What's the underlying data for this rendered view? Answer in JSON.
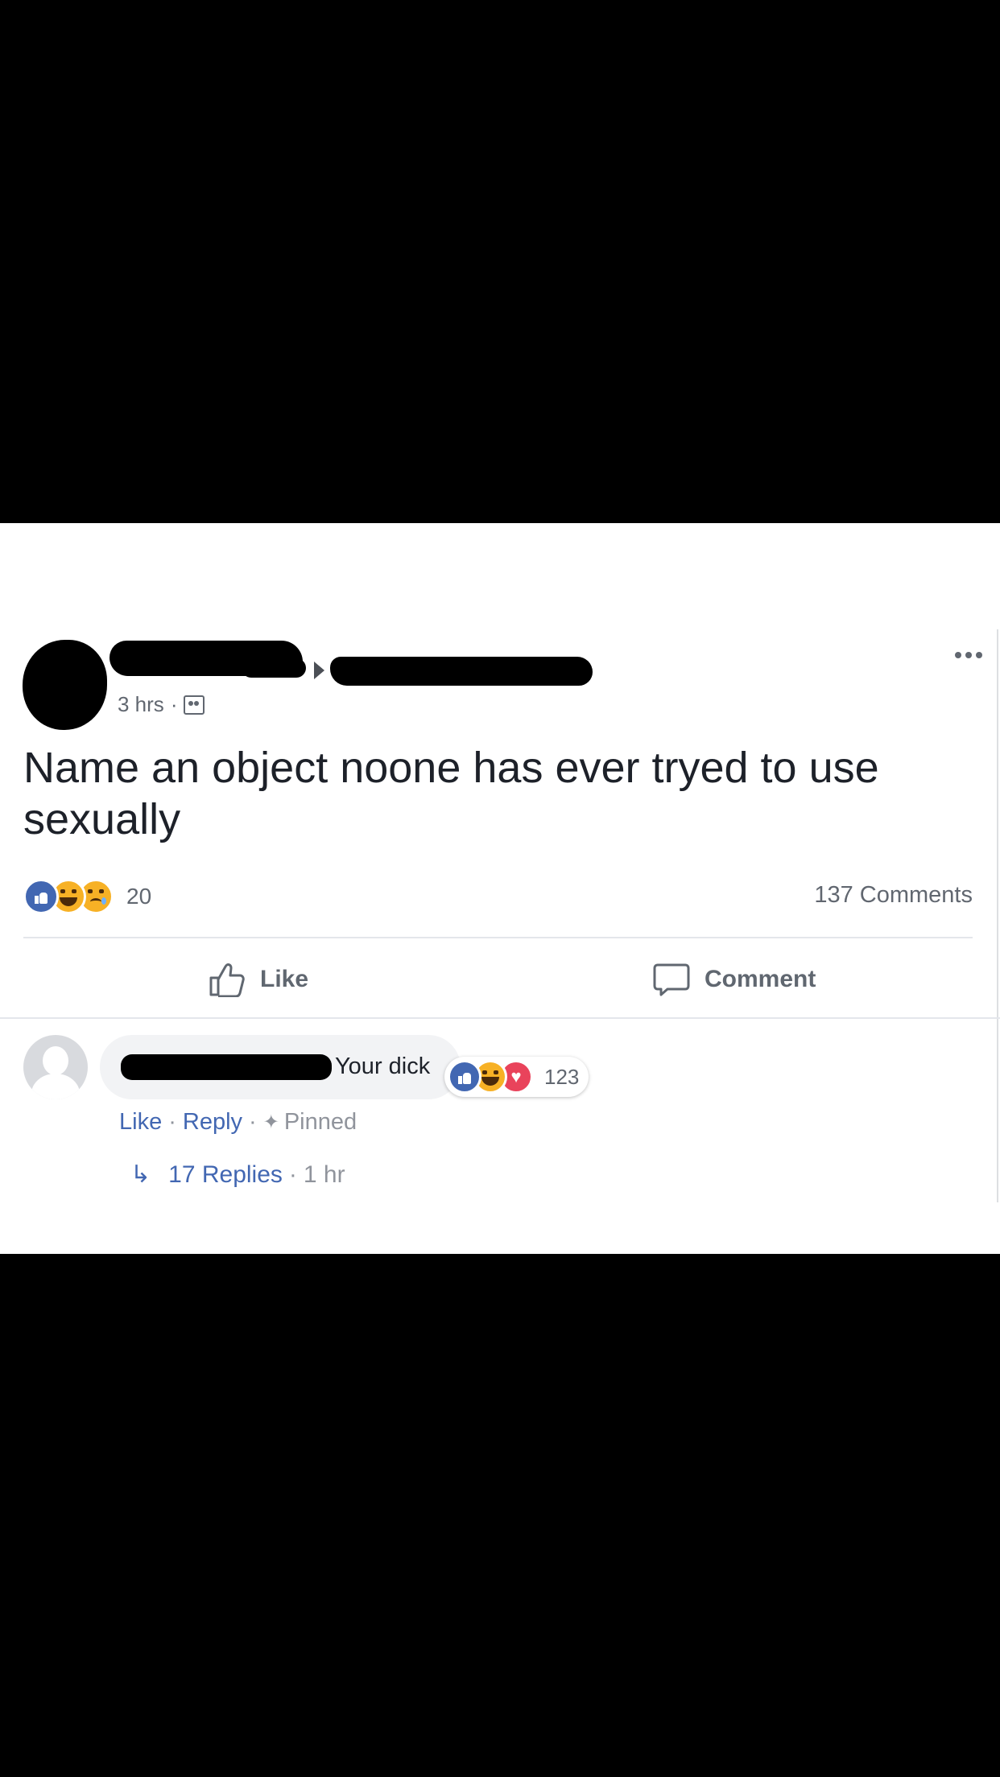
{
  "post": {
    "time": "3 hrs",
    "separator": "·",
    "audience_icon": "group-audience-icon",
    "text": "Name an object noone has ever tryed to use sexually",
    "reactions": {
      "icons": [
        "like-icon",
        "haha-icon",
        "sad-icon"
      ],
      "count": "20"
    },
    "comments_count": "137 Comments"
  },
  "actions": {
    "like_label": "Like",
    "comment_label": "Comment"
  },
  "comment": {
    "text": "Your dick",
    "reactions": {
      "icons": [
        "like-icon",
        "haha-icon",
        "love-icon"
      ],
      "count": "123"
    },
    "like_label": "Like",
    "reply_label": "Reply",
    "pinned_label": "Pinned",
    "replies_label": "17 Replies",
    "replies_time": "1 hr"
  },
  "colors": {
    "link_blue": "#4267b2",
    "text_dark": "#1d2129",
    "text_muted": "#616770",
    "love_red": "#e9435b",
    "emoji_yellow": "#f7b125"
  }
}
